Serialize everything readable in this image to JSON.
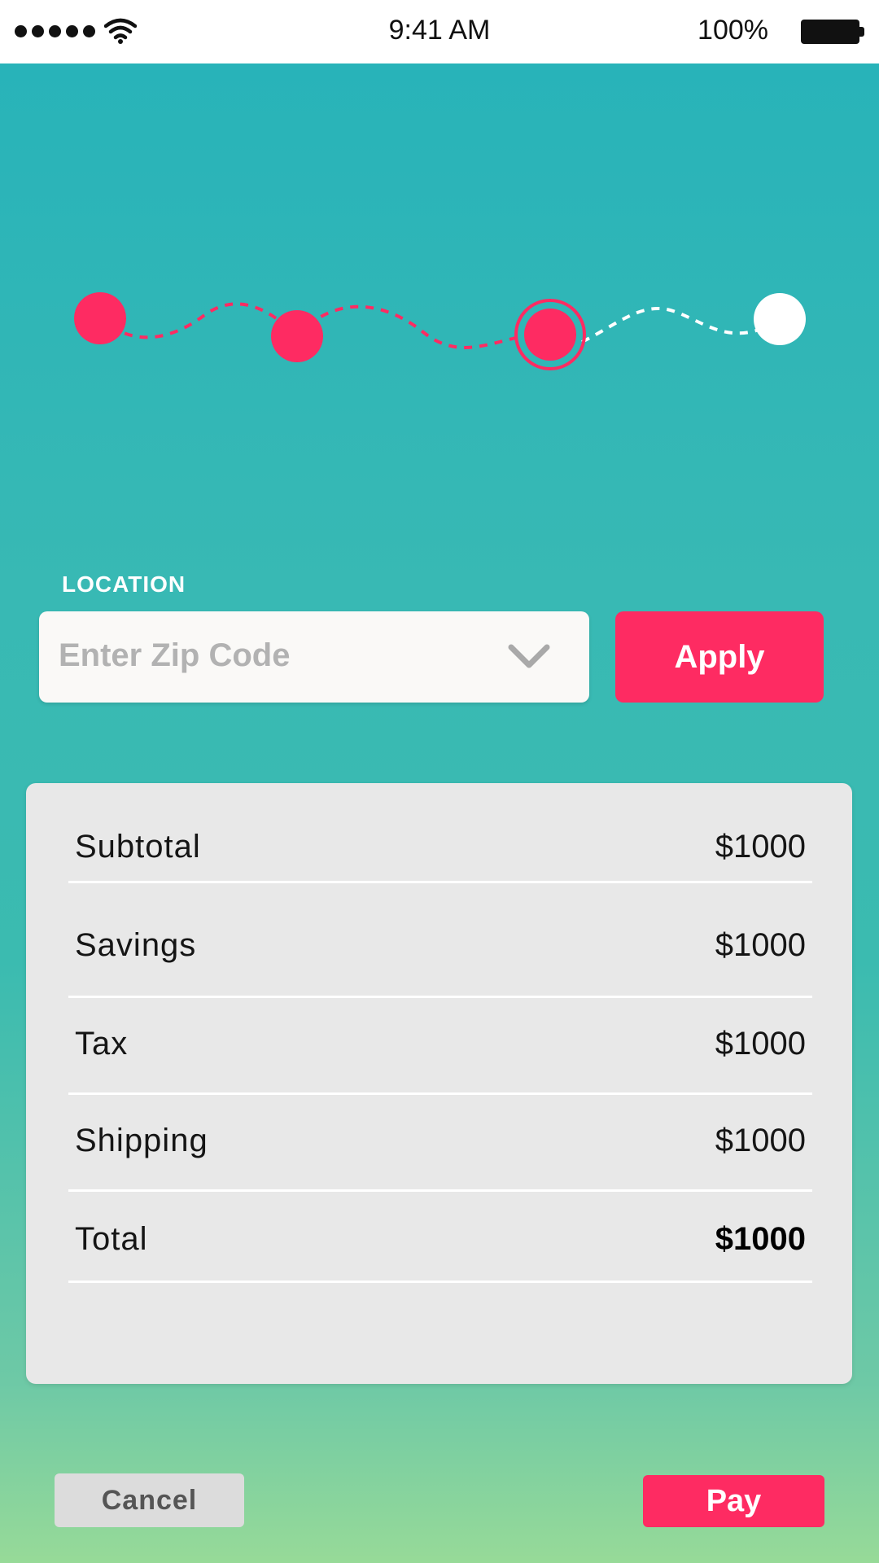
{
  "status_bar": {
    "time": "9:41 AM",
    "battery_percent": "100%",
    "icons": [
      "signal-dots-icon",
      "wifi-icon",
      "battery-icon"
    ]
  },
  "progress": {
    "steps_total": 4,
    "current_step": 3,
    "completed_color": "#fe2b62",
    "pending_color": "#ffffff"
  },
  "location": {
    "label": "LOCATION",
    "zip_placeholder": "Enter Zip Code",
    "apply_label": "Apply"
  },
  "summary": {
    "rows": [
      {
        "label": "Subtotal",
        "value": "$1000"
      },
      {
        "label": "Savings",
        "value": "$1000"
      },
      {
        "label": "Tax",
        "value": "$1000"
      },
      {
        "label": "Shipping",
        "value": "$1000"
      },
      {
        "label": "Total",
        "value": "$1000"
      }
    ]
  },
  "actions": {
    "cancel_label": "Cancel",
    "pay_label": "Pay"
  },
  "colors": {
    "accent": "#fe2b62",
    "background_top": "#28b3b9",
    "background_bottom": "#97da98",
    "card": "#e8e8e8"
  }
}
